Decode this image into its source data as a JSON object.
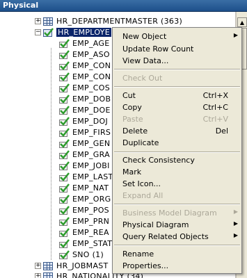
{
  "window": {
    "title": "Physical"
  },
  "tree": {
    "tables": [
      {
        "label": "HR_DEPARTMENTMASTER (363)"
      },
      {
        "label": "HR_EMPLOYE"
      },
      {
        "label": "HR_JOBMAST"
      },
      {
        "label": "HR_NATIONALITY (34)"
      }
    ],
    "columns": [
      "EMP_AGE",
      "EMP_ASO",
      "EMP_CON",
      "EMP_CON",
      "EMP_COS",
      "EMP_DOB",
      "EMP_DOE",
      "EMP_DOJ",
      "EMP_FIRS",
      "EMP_GEN",
      "EMP_GRA",
      "EMP_JOBI",
      "EMP_LAST",
      "EMP_NAT",
      "EMP_ORG",
      "EMP_POS",
      "EMP_PRN",
      "EMP_REA",
      "EMP_STAT",
      "SNO (1)"
    ]
  },
  "context_menu": {
    "new_object": "New Object",
    "update_row_count": "Update Row Count",
    "view_data": "View Data...",
    "check_out": "Check Out",
    "cut": "Cut",
    "cut_shortcut": "Ctrl+X",
    "copy": "Copy",
    "copy_shortcut": "Ctrl+C",
    "paste": "Paste",
    "paste_shortcut": "Ctrl+V",
    "delete": "Delete",
    "delete_shortcut": "Del",
    "duplicate": "Duplicate",
    "check_consistency": "Check Consistency",
    "mark": "Mark",
    "set_icon": "Set Icon...",
    "expand_all": "Expand All",
    "business_model_diagram": "Business Model Diagram",
    "physical_diagram": "Physical Diagram",
    "query_related_objects": "Query Related Objects",
    "rename": "Rename",
    "properties": "Properties..."
  },
  "colors": {
    "selection": "#0a246a",
    "menu_bg": "#ece9d8",
    "disabled": "#aca899",
    "title": "#1d4f8a"
  }
}
